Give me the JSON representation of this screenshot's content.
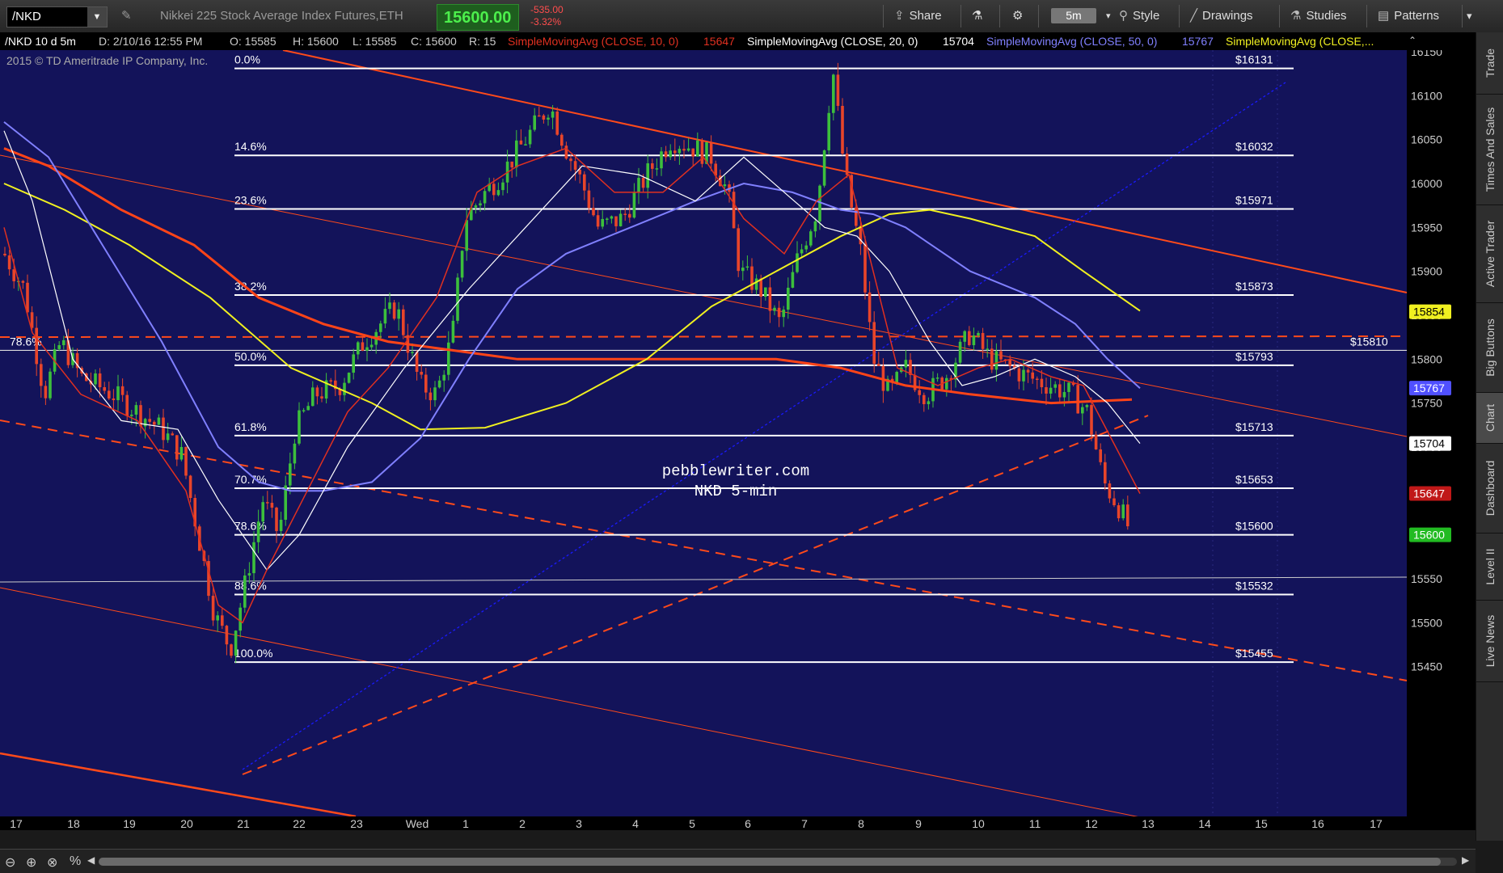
{
  "toolbar": {
    "symbol": "/NKD",
    "description": "Nikkei 225 Stock Average Index Futures,ETH",
    "last_price": "15600.00",
    "net_change": "-535.00",
    "pct_change": "-3.32%",
    "share_label": "Share",
    "aggregation": "5m",
    "style_label": "Style",
    "drawings_label": "Drawings",
    "studies_label": "Studies",
    "patterns_label": "Patterns"
  },
  "status_line": {
    "symbol_period": "/NKD 10 d 5m",
    "datetime": "D: 2/10/16 12:55 PM",
    "open": "O: 15585",
    "high": "H: 15600",
    "low": "L: 15585",
    "close": "C: 15600",
    "range": "R: 15",
    "sma10_label": "SimpleMovingAvg (CLOSE, 10, 0)",
    "sma10_value": "15647",
    "sma20_label": "SimpleMovingAvg (CLOSE, 20, 0)",
    "sma20_value": "15704",
    "sma50_label": "SimpleMovingAvg (CLOSE, 50, 0)",
    "sma50_value": "15767",
    "sma_last_label": "SimpleMovingAvg (CLOSE,..."
  },
  "chart": {
    "copyright": "2015 © TD Ameritrade IP Company, Inc.",
    "annotation_line1": "pebblewriter.com",
    "annotation_line2": "NKD 5-min",
    "colors": {
      "background": "#13135a",
      "up_candle": "#3cbf3c",
      "down_candle": "#e8452a",
      "sma10": "#e03020",
      "sma20": "#ffffff",
      "sma50": "#8080ff",
      "sma_yellow": "#f0f020",
      "sma_orange": "#ff4418",
      "fib_line": "#ffffff",
      "trend_line": "#ff4a1a",
      "up_trend_dotted": "#1a1aff"
    },
    "y_axis": {
      "min": 15430,
      "max": 16160,
      "ticks": [
        16150,
        16100,
        16050,
        16000,
        15950,
        15900,
        15850,
        15800,
        15750,
        15700,
        15650,
        15600,
        15550,
        15500,
        15450
      ]
    },
    "x_axis": {
      "labels": [
        "17",
        "18",
        "19",
        "20",
        "21",
        "22",
        "23",
        "Wed",
        "1",
        "2",
        "3",
        "4",
        "5",
        "6",
        "7",
        "8",
        "9",
        "10",
        "11",
        "12",
        "13",
        "14",
        "15",
        "16",
        "17"
      ]
    },
    "fib_levels": [
      {
        "pct": "0.0%",
        "price": 16131,
        "label": "$16131"
      },
      {
        "pct": "14.6%",
        "price": 16032,
        "label": "$16032"
      },
      {
        "pct": "23.6%",
        "price": 15971,
        "label": "$15971"
      },
      {
        "pct": "38.2%",
        "price": 15873,
        "label": "$15873"
      },
      {
        "pct": "50.0%",
        "price": 15793,
        "label": "$15793"
      },
      {
        "pct": "61.8%",
        "price": 15713,
        "label": "$15713"
      },
      {
        "pct": "70.7%",
        "price": 15653,
        "label": "$15653"
      },
      {
        "pct": "78.6%",
        "price": 15600,
        "label": "$15600"
      },
      {
        "pct": "88.6%",
        "price": 15532,
        "label": "$15532"
      },
      {
        "pct": "100.0%",
        "price": 15455,
        "label": "$15455"
      }
    ],
    "prior_fib": {
      "pct": "78.6%",
      "price": 15810,
      "label": "$15810"
    },
    "price_bubbles": [
      {
        "price": 15854,
        "label": "15854",
        "bg": "#f0f020",
        "fg": "#000000"
      },
      {
        "price": 15767,
        "label": "15767",
        "bg": "#5050ff",
        "fg": "#ffffff"
      },
      {
        "price": 15704,
        "label": "15704",
        "bg": "#ffffff",
        "fg": "#000000"
      },
      {
        "price": 15647,
        "label": "15647",
        "bg": "#c01818",
        "fg": "#ffffff"
      },
      {
        "price": 15600,
        "label": "15600",
        "bg": "#22bb22",
        "fg": "#ffffff"
      }
    ]
  },
  "sidebar": {
    "tabs": [
      "Trade",
      "Times And Sales",
      "Active Trader",
      "Big Buttons",
      "Chart",
      "Dashboard",
      "Level II",
      "Live News"
    ]
  }
}
